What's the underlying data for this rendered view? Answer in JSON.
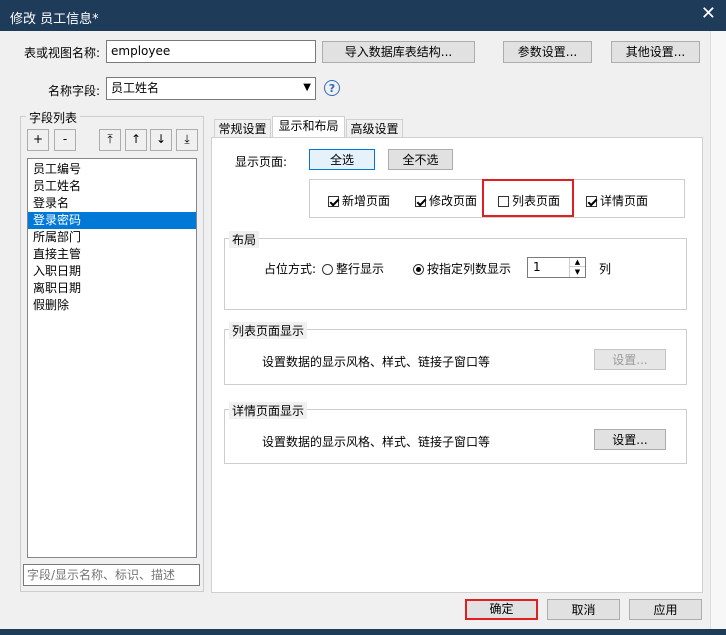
{
  "window": {
    "title": "修改 员工信息*",
    "close_glyph": "✕"
  },
  "top": {
    "table_label": "表或视图名称:",
    "table_value": "employee",
    "import_button": "导入数据库表结构...",
    "params_button": "参数设置...",
    "other_button": "其他设置...",
    "name_field_label": "名称字段:",
    "name_field_value": "员工姓名",
    "help_glyph": "?"
  },
  "fields_panel": {
    "title": "字段列表",
    "tool_buttons": [
      "+",
      "-",
      "⤒",
      "↑",
      "↓",
      "⤓"
    ],
    "items": [
      "员工编号",
      "员工姓名",
      "登录名",
      "登录密码",
      "所属部门",
      "直接主管",
      "入职日期",
      "离职日期",
      "假删除"
    ],
    "selected_index": 3,
    "search_placeholder": "字段/显示名称、标识、描述"
  },
  "tabs": [
    {
      "label": "常规设置"
    },
    {
      "label": "显示和布局"
    },
    {
      "label": "高级设置"
    }
  ],
  "display": {
    "label": "显示页面:",
    "select_all": "全选",
    "select_none": "全不选",
    "pages": [
      {
        "label": "新增页面",
        "checked": true
      },
      {
        "label": "修改页面",
        "checked": true
      },
      {
        "label": "列表页面",
        "checked": false
      },
      {
        "label": "详情页面",
        "checked": true
      }
    ]
  },
  "layout": {
    "legend": "布局",
    "position_label": "占位方式:",
    "option_full": "整行显示",
    "option_columns": "按指定列数显示",
    "columns_value": "1",
    "unit": "列"
  },
  "list_display": {
    "legend": "列表页面显示",
    "desc": "设置数据的显示风格、样式、链接子窗口等",
    "button": "设置..."
  },
  "detail_display": {
    "legend": "详情页面显示",
    "desc": "设置数据的显示风格、样式、链接子窗口等",
    "button": "设置..."
  },
  "footer": {
    "ok": "确定",
    "cancel": "取消",
    "apply": "应用"
  },
  "colors": {
    "highlight": "#e02020",
    "selection": "#0078d7",
    "titlebar": "#1f3b5a"
  }
}
